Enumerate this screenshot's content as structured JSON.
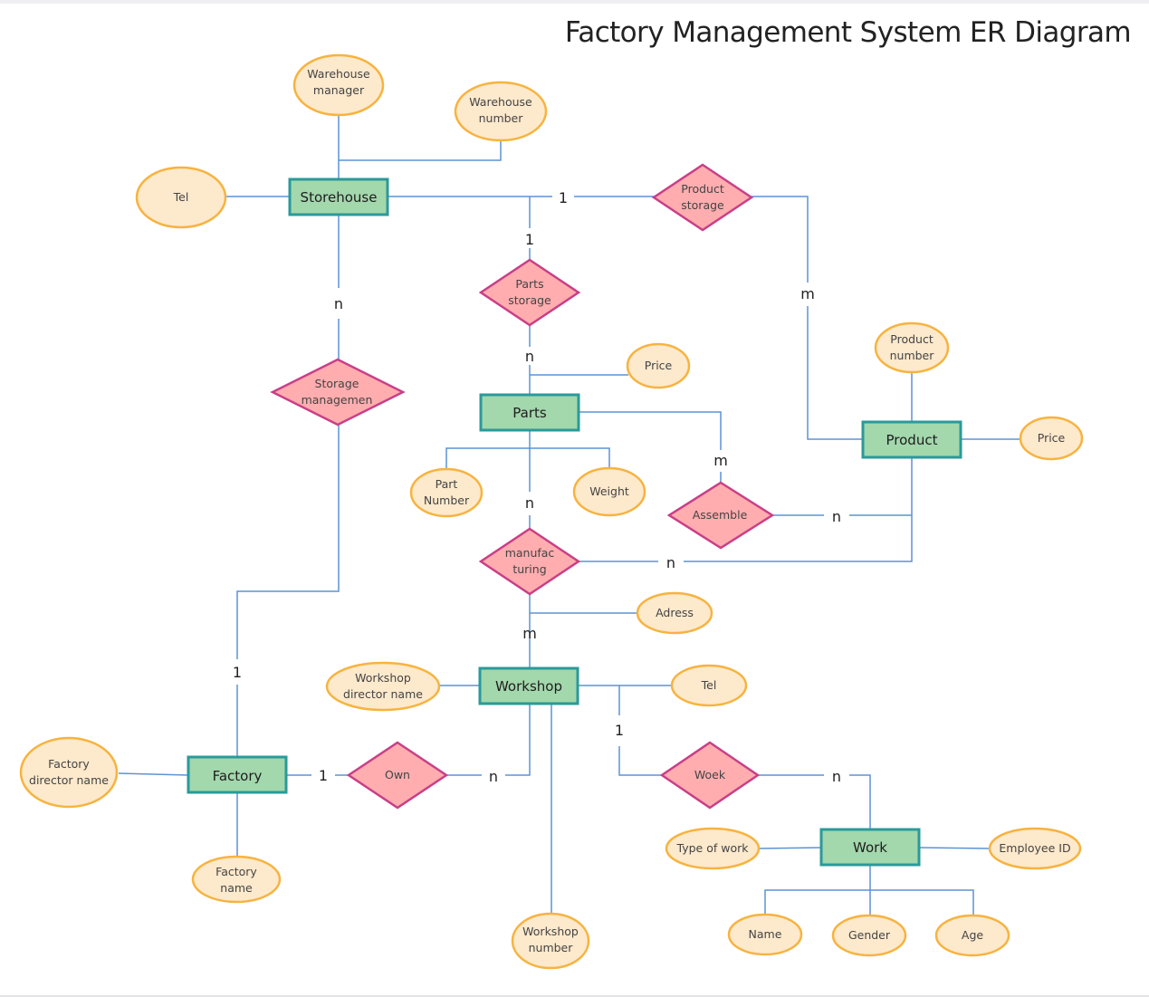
{
  "title": "Factory Management System ER Diagram",
  "colors": {
    "entity_fill": "#a3d7ac",
    "entity_border": "#2a9a9a",
    "relationship_fill": "#ffadaf",
    "relationship_border": "#c93f87",
    "attribute_fill": "#fde9cc",
    "attribute_border": "#f7b33f",
    "connector": "#5b93d6"
  },
  "entities": {
    "storehouse": "Storehouse",
    "parts": "Parts",
    "product": "Product",
    "workshop": "Workshop",
    "factory": "Factory",
    "work": "Work"
  },
  "relationships": {
    "product_storage": [
      "Product",
      "storage"
    ],
    "parts_storage": [
      "Parts",
      "storage"
    ],
    "storage_management": [
      "Storage",
      "managemen"
    ],
    "assemble": [
      "Assemble"
    ],
    "manufacturing": [
      "manufac",
      "turing"
    ],
    "own": [
      "Own"
    ],
    "woek": [
      "Woek"
    ]
  },
  "attributes": {
    "warehouse_manager": [
      "Warehouse",
      "manager"
    ],
    "warehouse_number": [
      "Warehouse",
      "number"
    ],
    "storehouse_tel": [
      "Tel"
    ],
    "parts_price": [
      "Price"
    ],
    "part_number": [
      "Part",
      "Number"
    ],
    "weight": [
      "Weight"
    ],
    "product_number": [
      "Product",
      "number"
    ],
    "product_price": [
      "Price"
    ],
    "adress": [
      "Adress"
    ],
    "workshop_director_name": [
      "Workshop",
      "director name"
    ],
    "workshop_tel": [
      "Tel"
    ],
    "workshop_number": [
      "Workshop",
      "number"
    ],
    "factory_director_name": [
      "Factory",
      "director name"
    ],
    "factory_name": [
      "Factory",
      "name"
    ],
    "type_of_work": [
      "Type of work"
    ],
    "employee_id": [
      "Employee ID"
    ],
    "name": [
      "Name"
    ],
    "gender": [
      "Gender"
    ],
    "age": [
      "Age"
    ]
  },
  "cardinalities": {
    "storehouse_product_storage": "1",
    "storehouse_parts_storage": "1",
    "product_storage_product": "m",
    "storehouse_storage_management": "n",
    "parts_storage_parts": "n",
    "parts_assemble": "m",
    "assemble_product": "n",
    "parts_manufacturing": "n",
    "manufacturing_product": "n",
    "manufacturing_workshop": "m",
    "storage_management_factory": "1",
    "factory_own": "1",
    "own_workshop": "n",
    "workshop_woek": "1",
    "woek_work": "n"
  }
}
